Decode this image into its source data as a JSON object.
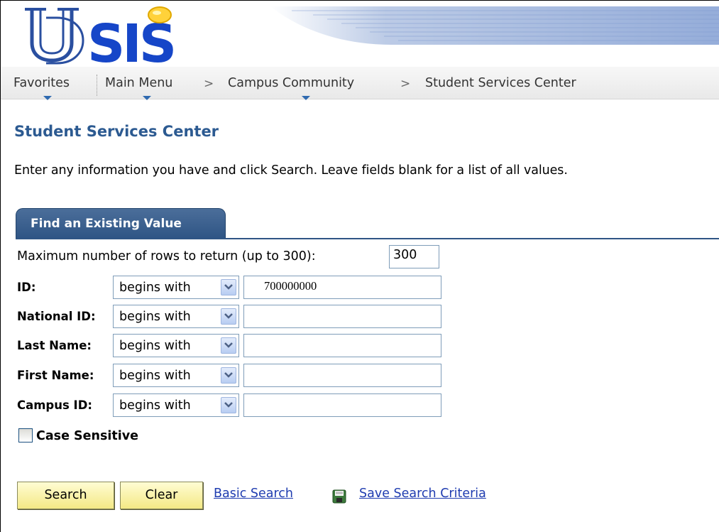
{
  "header": {
    "logo_text": "UDSIS"
  },
  "nav": {
    "favorites": "Favorites",
    "main_menu": "Main Menu",
    "campus_community": "Campus Community",
    "current": "Student Services Center",
    "separator": ">"
  },
  "page": {
    "title": "Student Services Center",
    "instructions": "Enter any information you have and click Search. Leave fields blank for a list of all values."
  },
  "tab": {
    "label": "Find an Existing Value"
  },
  "form": {
    "max_rows_label": "Maximum number of rows to return (up to 300):",
    "max_rows_value": "300",
    "fields": [
      {
        "label": "ID:",
        "operator": "begins with",
        "value": "700000000"
      },
      {
        "label": "National ID:",
        "operator": "begins with",
        "value": ""
      },
      {
        "label": "Last Name:",
        "operator": "begins with",
        "value": ""
      },
      {
        "label": "First Name:",
        "operator": "begins with",
        "value": ""
      },
      {
        "label": "Campus ID:",
        "operator": "begins with",
        "value": ""
      }
    ],
    "case_sensitive_label": "Case Sensitive",
    "case_sensitive_checked": false
  },
  "actions": {
    "search": "Search",
    "clear": "Clear",
    "basic_search": "Basic Search",
    "save_search_criteria": "Save Search Criteria"
  },
  "colors": {
    "title_blue": "#2c5a91",
    "tab_blue": "#2f5585",
    "button_yellow": "#f4e985",
    "link_blue": "#1f3cb0"
  }
}
